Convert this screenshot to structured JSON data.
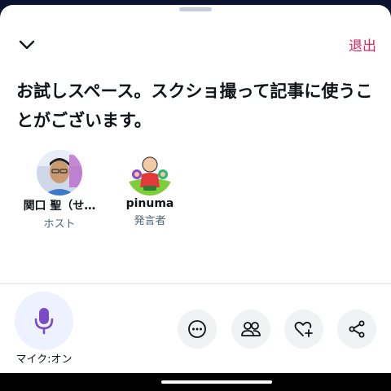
{
  "header": {
    "collapse_icon": "chevron-down-icon",
    "leave_label": "退出"
  },
  "space": {
    "title": "お試しスペース。スクショ撮って記事に使うことがございます。"
  },
  "participants": [
    {
      "name": "関口 聖（せ…",
      "role": "ホスト",
      "avatar": "host-avatar-photo"
    },
    {
      "name": "pinuma",
      "role": "発言者",
      "avatar": "speaker-avatar-illustration"
    }
  ],
  "controls": {
    "mic_label": "マイク:オン",
    "mic_icon": "microphone-icon",
    "actions": [
      {
        "icon": "more-icon"
      },
      {
        "icon": "people-icon"
      },
      {
        "icon": "heart-plus-icon"
      },
      {
        "icon": "share-icon"
      }
    ]
  },
  "colors": {
    "accent": "#794bc4",
    "leave": "#e0245e",
    "secondary_text": "#536471"
  }
}
